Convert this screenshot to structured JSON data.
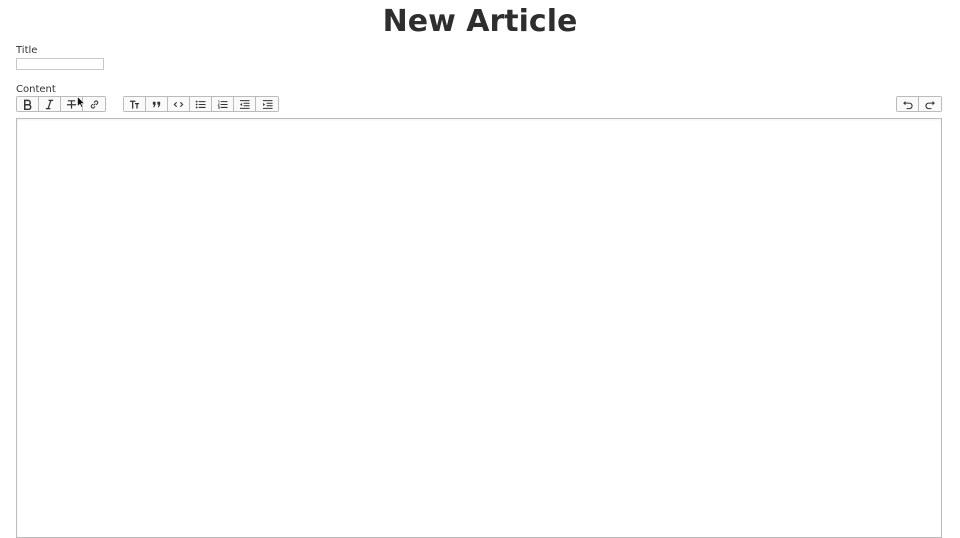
{
  "page": {
    "title": "New Article"
  },
  "form": {
    "title_label": "Title",
    "title_value": "",
    "content_label": "Content",
    "content_value": ""
  },
  "toolbar": {
    "inline_buttons": [
      "bold-icon",
      "italic-icon",
      "strikethrough-icon",
      "link-icon"
    ],
    "block_buttons": [
      "heading-icon",
      "quote-icon",
      "code-icon",
      "bullet-list-icon",
      "numbered-list-icon",
      "outdent-icon",
      "indent-icon"
    ],
    "history_buttons": [
      "undo-icon",
      "redo-icon"
    ]
  },
  "colors": {
    "text": "#333333",
    "border": "#bbbbbb",
    "toolbar_bg": "#fafafa"
  }
}
